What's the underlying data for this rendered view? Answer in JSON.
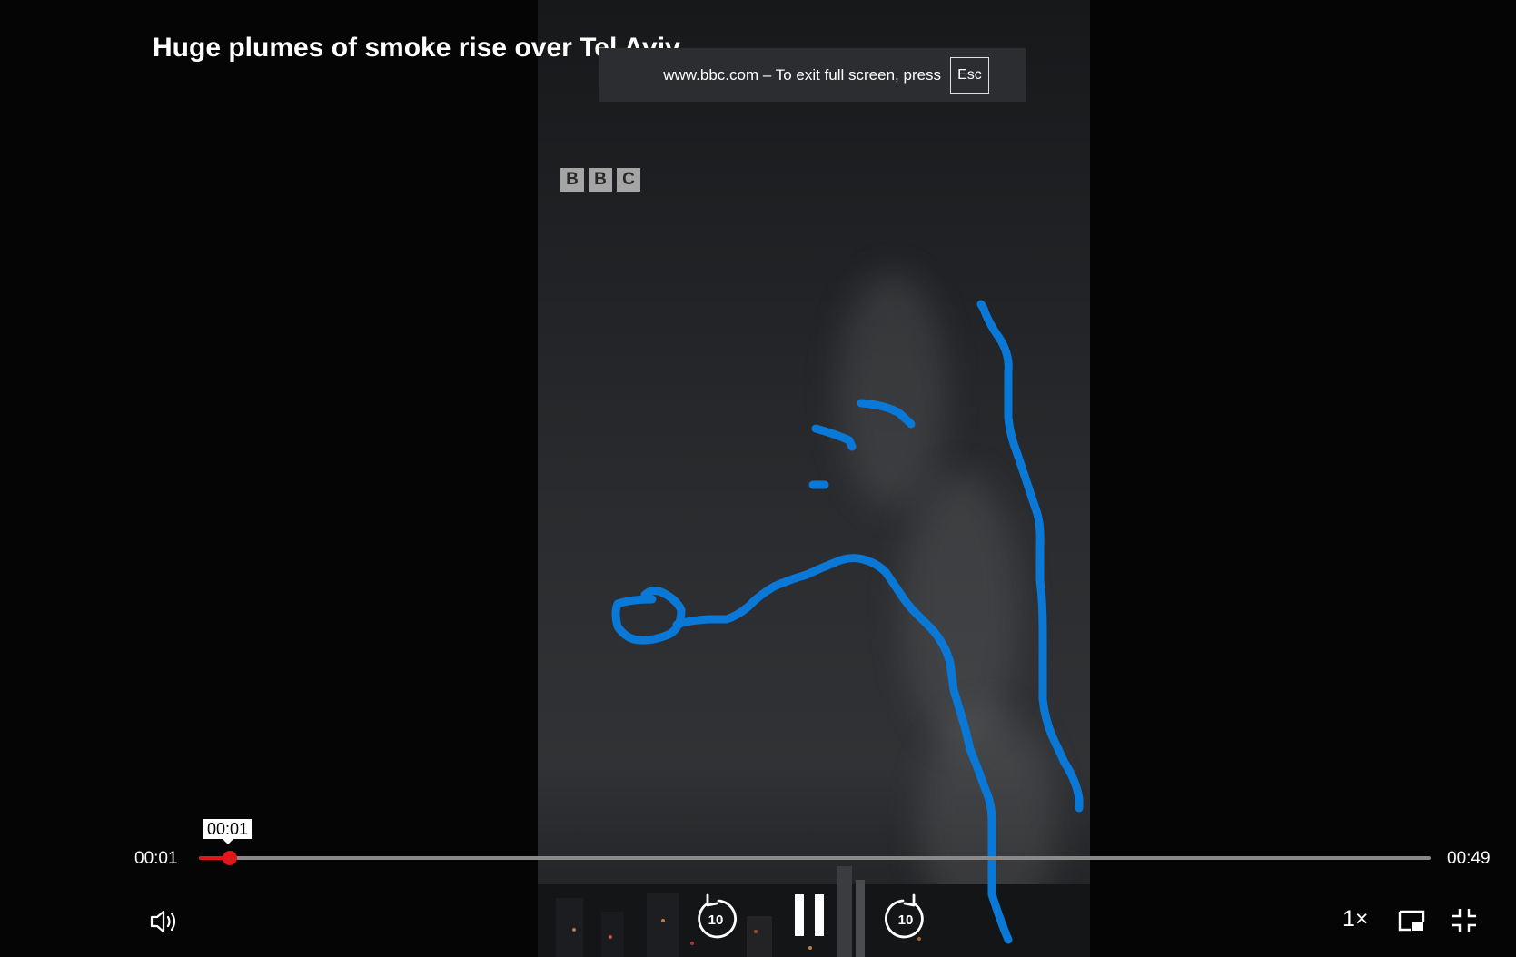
{
  "video": {
    "title": "Huge plumes of smoke rise over Tel Aviv",
    "logo_letters": [
      "B",
      "B",
      "C"
    ]
  },
  "fullscreen_notice": {
    "text": "www.bbc.com – To exit full screen, press",
    "key": "Esc"
  },
  "player": {
    "current_time": "00:01",
    "total_time": "00:49",
    "tooltip_time": "00:01",
    "progress_fraction": 0.025,
    "skip_back_label": "10",
    "skip_forward_label": "10",
    "playback_speed": "1×",
    "state": "playing"
  },
  "colors": {
    "progress": "#e0161b",
    "annotation": "#0a78d7",
    "notice_bg": "#2b2d31"
  },
  "icons": {
    "volume": "volume-icon",
    "skip_back": "rewind-10-icon",
    "pause": "pause-icon",
    "skip_forward": "forward-10-icon",
    "pip": "picture-in-picture-icon",
    "exit_fullscreen": "exit-fullscreen-icon"
  }
}
